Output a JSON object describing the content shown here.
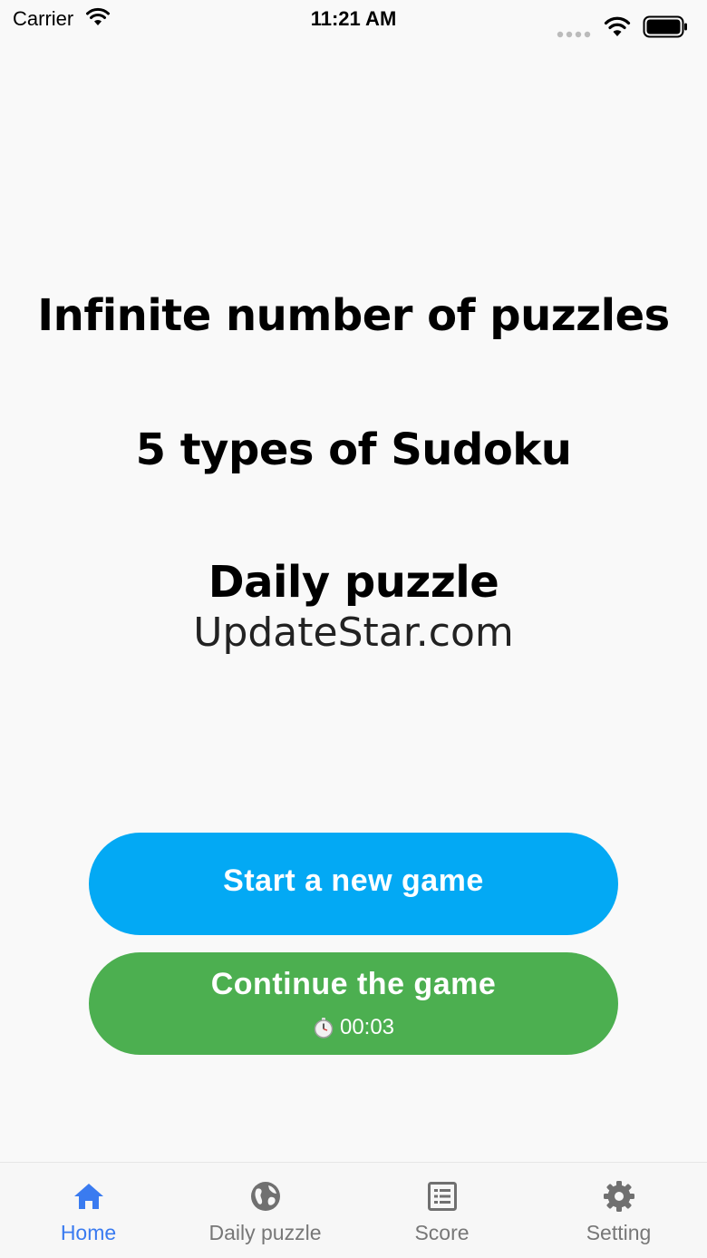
{
  "status_bar": {
    "carrier": "Carrier",
    "time": "11:21 AM"
  },
  "headlines": {
    "line1": "Infinite number of puzzles",
    "line2": "5 types of Sudoku",
    "line3": "Daily puzzle"
  },
  "watermark": "UpdateStar.com",
  "buttons": {
    "new_game": "Start a new game",
    "continue_game": "Continue the game",
    "elapsed_time": "00:03"
  },
  "tabs": [
    {
      "label": "Home",
      "icon": "home-icon",
      "active": true
    },
    {
      "label": "Daily puzzle",
      "icon": "globe-icon",
      "active": false
    },
    {
      "label": "Score",
      "icon": "list-icon",
      "active": false
    },
    {
      "label": "Setting",
      "icon": "gear-icon",
      "active": false
    }
  ],
  "colors": {
    "new_game_button": "#03a9f4",
    "continue_button": "#4caf50",
    "active_tab": "#3a7bf0",
    "inactive_tab": "#777777"
  }
}
